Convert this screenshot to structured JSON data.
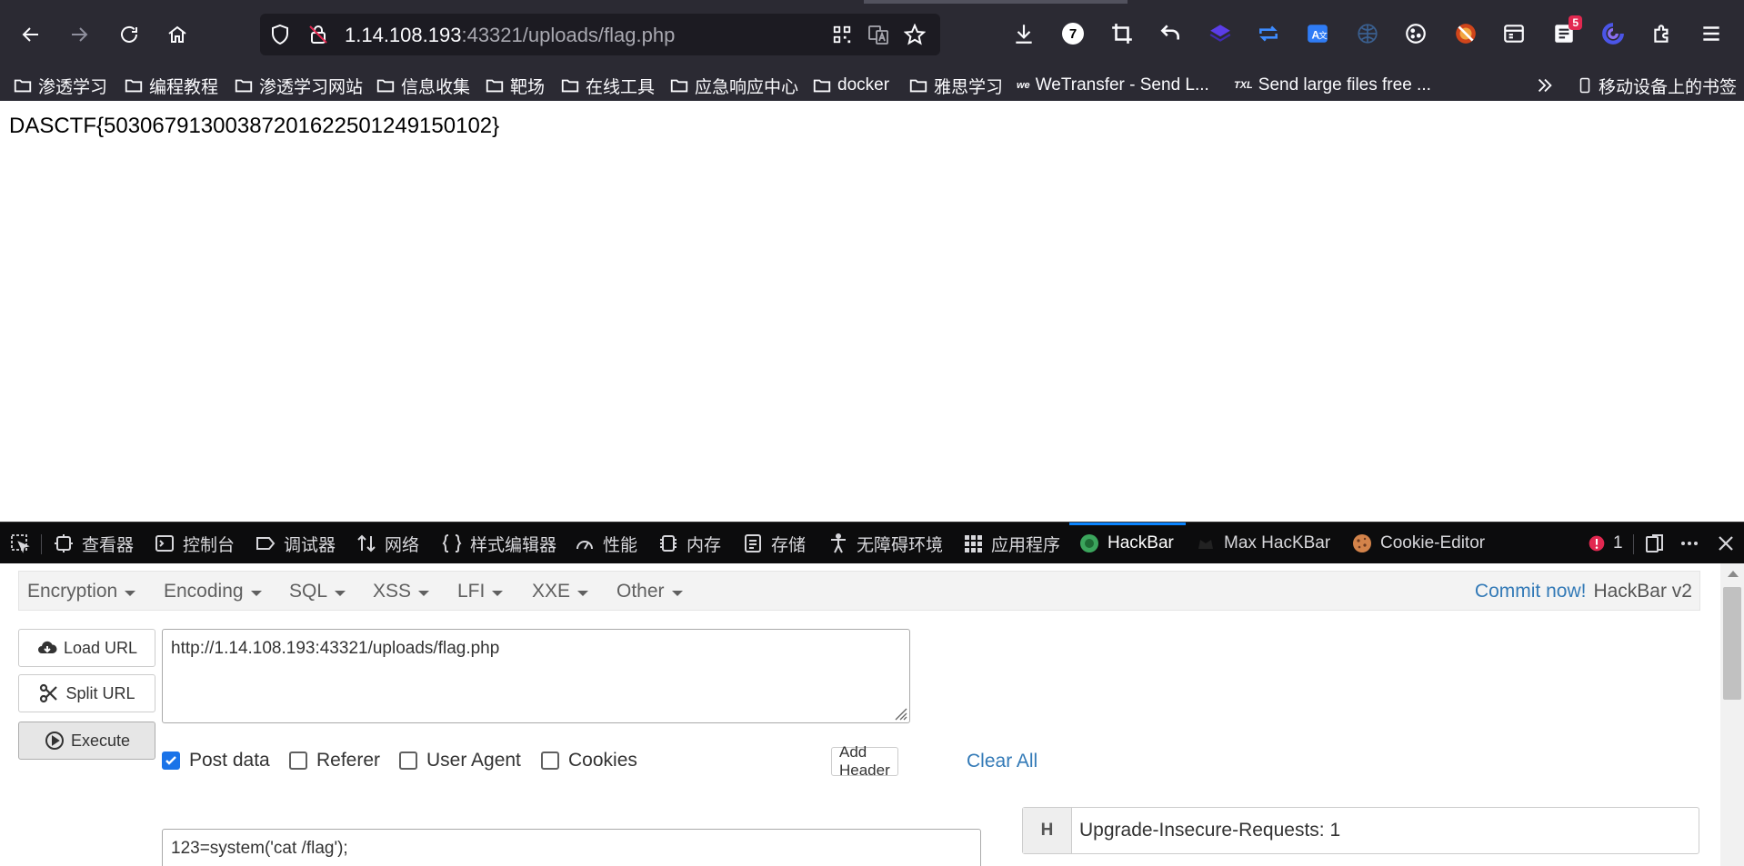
{
  "browser": {
    "url_host": "1.14.108.193",
    "url_rest": ":43321/uploads/flag.php",
    "extensions": [
      {
        "icon": "qr-code-icon"
      },
      {
        "icon": "translate-icon"
      },
      {
        "icon": "bookmark-star-icon"
      }
    ],
    "toolbar_badges": {
      "seven": "7",
      "five": "5"
    }
  },
  "bookmarks": [
    {
      "label": "渗透学习",
      "icon": "folder-icon"
    },
    {
      "label": "编程教程",
      "icon": "folder-icon"
    },
    {
      "label": "渗透学习网站",
      "icon": "folder-icon"
    },
    {
      "label": "信息收集",
      "icon": "folder-icon"
    },
    {
      "label": "靶场",
      "icon": "folder-icon"
    },
    {
      "label": "在线工具",
      "icon": "folder-icon"
    },
    {
      "label": "应急响应中心",
      "icon": "folder-icon"
    },
    {
      "label": "docker",
      "icon": "folder-icon"
    },
    {
      "label": "雅思学习",
      "icon": "folder-icon"
    },
    {
      "label": "WeTransfer - Send L...",
      "icon": "we-logo-icon",
      "logo_text": "we"
    },
    {
      "label": "Send large files free ...",
      "icon": "txl-logo-icon",
      "logo_text": "TXL"
    }
  ],
  "mobile_bookmarks": "移动设备上的书签",
  "page": {
    "flag": "DASCTF{50306791300387201622501249150102}"
  },
  "devtools": {
    "tabs": [
      {
        "label": "查看器",
        "icon": "inspector-icon"
      },
      {
        "label": "控制台",
        "icon": "console-icon"
      },
      {
        "label": "调试器",
        "icon": "debugger-icon"
      },
      {
        "label": "网络",
        "icon": "network-icon"
      },
      {
        "label": "样式编辑器",
        "icon": "style-editor-icon"
      },
      {
        "label": "性能",
        "icon": "performance-icon"
      },
      {
        "label": "内存",
        "icon": "memory-icon"
      },
      {
        "label": "存储",
        "icon": "storage-icon"
      },
      {
        "label": "无障碍环境",
        "icon": "accessibility-icon"
      },
      {
        "label": "应用程序",
        "icon": "application-icon"
      },
      {
        "label": "HackBar",
        "icon": "hackbar-icon",
        "active": true
      },
      {
        "label": "Max HacKBar",
        "icon": "max-hackbar-icon"
      },
      {
        "label": "Cookie-Editor",
        "icon": "cookie-icon"
      }
    ],
    "error_count": "1"
  },
  "hackbar": {
    "menus": [
      "Encryption",
      "Encoding",
      "SQL",
      "XSS",
      "LFI",
      "XXE",
      "Other"
    ],
    "commit_link": "Commit now!",
    "version": "HackBar v2",
    "load_url": "Load URL",
    "split_url": "Split URL",
    "execute": "Execute",
    "url_value": "http://1.14.108.193:43321/uploads/flag.php",
    "options": {
      "post_data": {
        "label": "Post data",
        "checked": true
      },
      "referer": {
        "label": "Referer",
        "checked": false
      },
      "user_agent": {
        "label": "User Agent",
        "checked": false
      },
      "cookies": {
        "label": "Cookies",
        "checked": false
      }
    },
    "add_header": "Add Header",
    "clear_all": "Clear All",
    "post_body": "123=system('cat /flag');",
    "header_key": "H",
    "header_value": "Upgrade-Insecure-Requests: 1"
  }
}
